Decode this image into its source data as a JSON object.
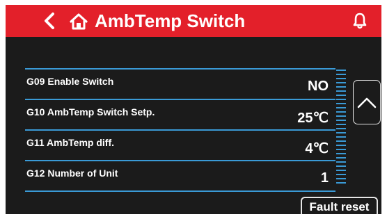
{
  "header": {
    "title": "AmbTemp Switch",
    "back_icon": "chevron-left-icon",
    "home_icon": "home-icon",
    "bell_icon": "bell-icon"
  },
  "rows": [
    {
      "label": "G09 Enable Switch",
      "value": "NO"
    },
    {
      "label": "G10 AmbTemp Switch Setp.",
      "value": "25℃"
    },
    {
      "label": "G11 AmbTemp diff.",
      "value": "4℃"
    },
    {
      "label": "G12 Number of Unit",
      "value": "1"
    }
  ],
  "scroll_up_icon": "chevron-up-icon",
  "fault_reset_label": "Fault reset",
  "colors": {
    "header_red": "#e3202a",
    "background": "#1b1b1b",
    "accent_blue": "#3a9ad6"
  }
}
